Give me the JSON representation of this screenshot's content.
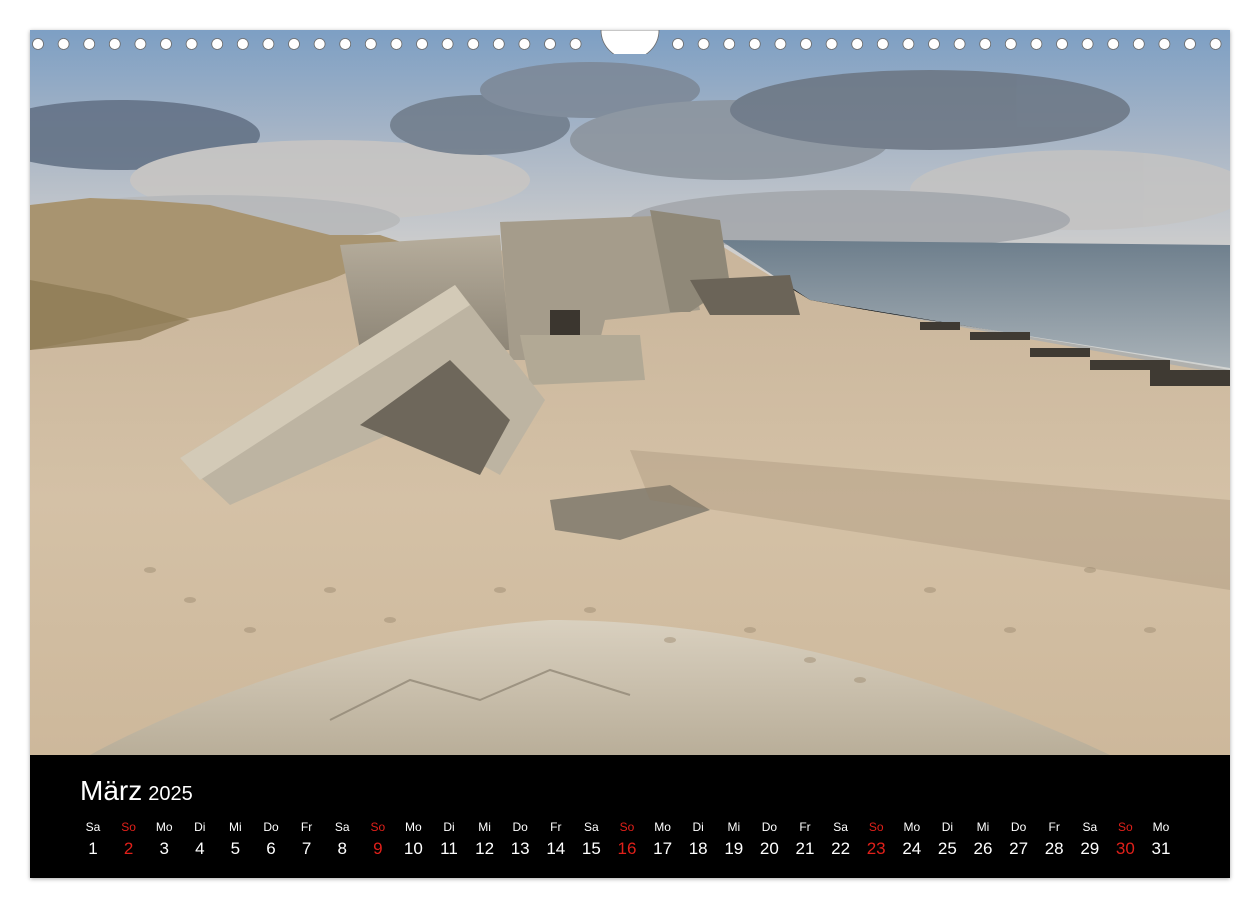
{
  "calendar": {
    "month": "März",
    "year": "2025",
    "accent_color": "#e0201a",
    "days": [
      {
        "wd": "Sa",
        "num": "1"
      },
      {
        "wd": "So",
        "num": "2",
        "sunday": true
      },
      {
        "wd": "Mo",
        "num": "3"
      },
      {
        "wd": "Di",
        "num": "4"
      },
      {
        "wd": "Mi",
        "num": "5"
      },
      {
        "wd": "Do",
        "num": "6"
      },
      {
        "wd": "Fr",
        "num": "7"
      },
      {
        "wd": "Sa",
        "num": "8"
      },
      {
        "wd": "So",
        "num": "9",
        "sunday": true
      },
      {
        "wd": "Mo",
        "num": "10"
      },
      {
        "wd": "Di",
        "num": "11"
      },
      {
        "wd": "Mi",
        "num": "12"
      },
      {
        "wd": "Do",
        "num": "13"
      },
      {
        "wd": "Fr",
        "num": "14"
      },
      {
        "wd": "Sa",
        "num": "15"
      },
      {
        "wd": "So",
        "num": "16",
        "sunday": true
      },
      {
        "wd": "Mo",
        "num": "17"
      },
      {
        "wd": "Di",
        "num": "18"
      },
      {
        "wd": "Mi",
        "num": "19"
      },
      {
        "wd": "Do",
        "num": "20"
      },
      {
        "wd": "Fr",
        "num": "21"
      },
      {
        "wd": "Sa",
        "num": "22"
      },
      {
        "wd": "So",
        "num": "23",
        "sunday": true
      },
      {
        "wd": "Mo",
        "num": "24"
      },
      {
        "wd": "Di",
        "num": "25"
      },
      {
        "wd": "Mi",
        "num": "26"
      },
      {
        "wd": "Do",
        "num": "27"
      },
      {
        "wd": "Fr",
        "num": "28"
      },
      {
        "wd": "Sa",
        "num": "29"
      },
      {
        "wd": "So",
        "num": "30",
        "sunday": true
      },
      {
        "wd": "Mo",
        "num": "31"
      }
    ]
  }
}
